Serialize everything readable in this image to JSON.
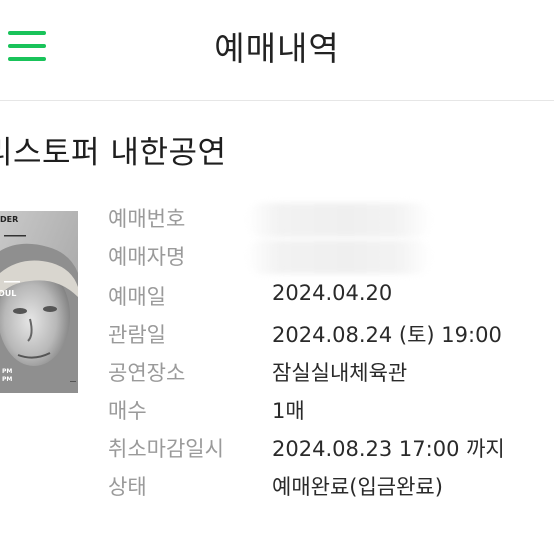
{
  "header": {
    "title": "예매내역"
  },
  "show": {
    "title": "리스토퍼 내한공연",
    "poster_text": {
      "top": "DER",
      "mid": "OUL",
      "pm1": "PM",
      "pm2": "PM"
    }
  },
  "details": [
    {
      "label": "예매번호",
      "value": ""
    },
    {
      "label": "예매자명",
      "value": ""
    },
    {
      "label": "예매일",
      "value": "2024.04.20"
    },
    {
      "label": "관람일",
      "value": "2024.08.24 (토) 19:00"
    },
    {
      "label": "공연장소",
      "value": "잠실실내체육관"
    },
    {
      "label": "매수",
      "value": "1매"
    },
    {
      "label": "취소마감일시",
      "value": "2024.08.23 17:00 까지"
    },
    {
      "label": "상태",
      "value": "예매완료(입금완료)"
    }
  ],
  "colors": {
    "accent": "#19c35a",
    "label": "#9a9a9a",
    "value": "#2a2a2a"
  }
}
